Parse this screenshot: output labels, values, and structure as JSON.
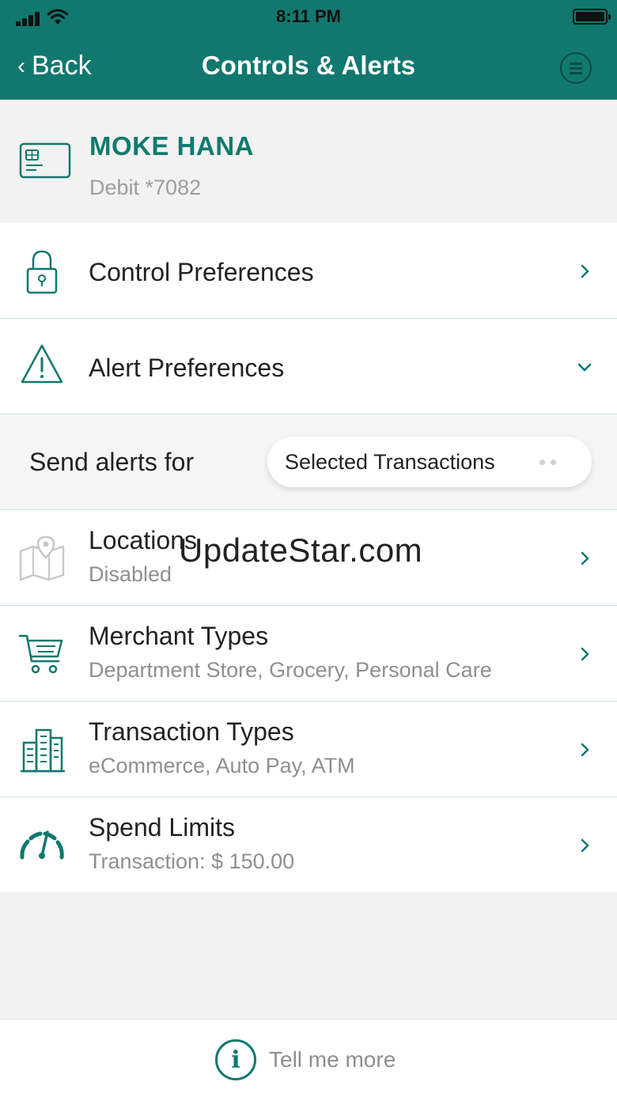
{
  "status_bar": {
    "time": "8:11 PM"
  },
  "nav": {
    "back_label": "Back",
    "title": "Controls & Alerts",
    "menu_icon": "menu-circle-icon"
  },
  "card": {
    "name": "MOKE HANA",
    "number": "Debit *7082",
    "icon": "debit-card-icon"
  },
  "preferences": [
    {
      "title": "Control Preferences",
      "icon": "lock-icon",
      "chevron": "right"
    },
    {
      "title": "Alert Preferences",
      "icon": "warning-icon",
      "chevron": "down"
    }
  ],
  "alerts": {
    "label": "Send alerts for",
    "selected": "Selected Transactions"
  },
  "filters": [
    {
      "title": "Locations",
      "subtitle": "Disabled",
      "icon": "map-pin-icon"
    },
    {
      "title": "Merchant Types",
      "subtitle": "Department Store, Grocery, Personal Care",
      "icon": "shopping-cart-icon"
    },
    {
      "title": "Transaction Types",
      "subtitle": "eCommerce, Auto Pay, ATM",
      "icon": "buildings-icon"
    },
    {
      "title": "Spend Limits",
      "subtitle": "Transaction: $ 150.00",
      "icon": "speedometer-icon"
    }
  ],
  "watermark": "UpdateStar.com",
  "footer": {
    "label": "Tell me more",
    "icon_glyph": "i"
  },
  "colors": {
    "accent": "#10786e",
    "card_name": "#117a6e",
    "divider": "#cfe3de",
    "muted_text": "#8f8f8f"
  }
}
